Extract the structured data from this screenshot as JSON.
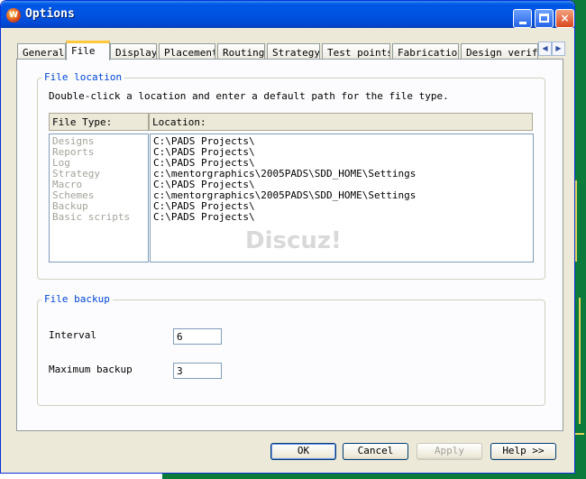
{
  "window": {
    "title": "Options",
    "app_icon_glyph": "W",
    "controls": {
      "minimize": "minimize-icon",
      "maximize": "maximize-icon",
      "close": "×"
    }
  },
  "tabs": [
    {
      "label": "General",
      "active": false
    },
    {
      "label": "File",
      "active": true
    },
    {
      "label": "Display",
      "active": false
    },
    {
      "label": "Placement",
      "active": false
    },
    {
      "label": "Routing",
      "active": false
    },
    {
      "label": "Strategy",
      "active": false
    },
    {
      "label": "Test points",
      "active": false
    },
    {
      "label": "Fabrication",
      "active": false
    },
    {
      "label": "Design verifi",
      "active": false
    }
  ],
  "tab_scroll": {
    "left": "◀",
    "right": "▶"
  },
  "file_location": {
    "group_label": "File location",
    "instruction": "Double-click a location and enter a default path for the file type.",
    "col_type": "File Type:",
    "col_location": "Location:",
    "file_types": [
      "Designs",
      "Reports",
      "Log",
      "Strategy",
      "Macro",
      "Schemes",
      "Backup",
      "Basic scripts"
    ],
    "locations": [
      "C:\\PADS Projects\\",
      "C:\\PADS Projects\\",
      "C:\\PADS Projects\\",
      "c:\\mentorgraphics\\2005PADS\\SDD_HOME\\Settings",
      "C:\\PADS Projects\\",
      "c:\\mentorgraphics\\2005PADS\\SDD_HOME\\Settings",
      "C:\\PADS Projects\\",
      "C:\\PADS Projects\\"
    ],
    "watermark": "Discuz!"
  },
  "file_backup": {
    "group_label": "File backup",
    "interval_label": "Interval",
    "interval_value": "6",
    "max_backup_label": "Maximum backup",
    "max_backup_value": "3"
  },
  "buttons": {
    "ok": "OK",
    "cancel": "Cancel",
    "apply": "Apply",
    "help": "Help >>"
  },
  "colors": {
    "title_blue": "#0054e3",
    "group_label": "#0046d5",
    "active_tab_accent": "#ffc83c",
    "pcb_green": "#0b7a3a"
  }
}
